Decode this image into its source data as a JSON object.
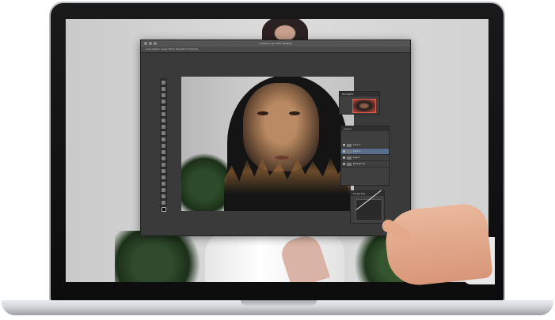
{
  "photoshop": {
    "window_title": "Untitled-1 @ 100% (RGB/8)",
    "options_bar": "Auto-Select: Layer  Show Transform Controls",
    "panels": {
      "navigator_label": "Navigator",
      "layers_label": "Layers",
      "properties_label": "Properties",
      "layers": [
        {
          "name": "Layer 3",
          "selected": false
        },
        {
          "name": "Layer 2",
          "selected": true
        },
        {
          "name": "Layer 1",
          "selected": false
        },
        {
          "name": "Background",
          "selected": false
        }
      ]
    }
  },
  "colors": {
    "laptop_bezel": "#111111",
    "ps_background": "#3a3a3a",
    "selected_layer": "#5a6e8c"
  }
}
